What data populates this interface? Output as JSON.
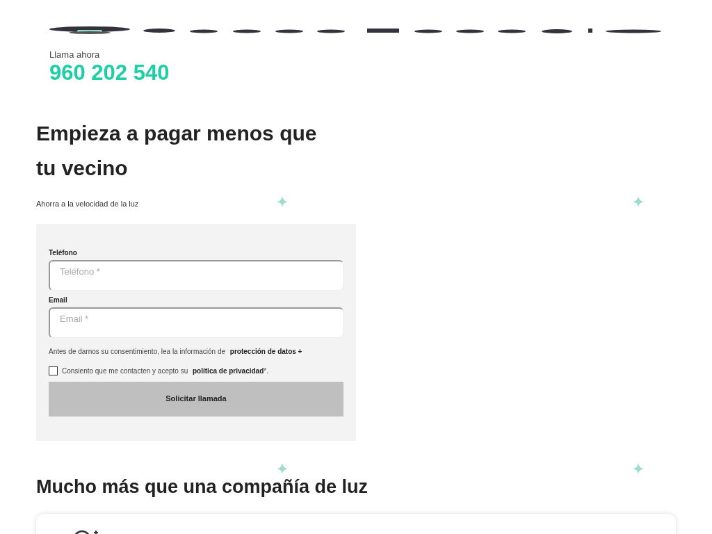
{
  "header": {
    "call_label": "Llama ahora",
    "phone": "960 202 540"
  },
  "hero": {
    "title": "Empieza a pagar menos que tu vecino",
    "subtitle": "Ahorra a la velocidad de la luz"
  },
  "form": {
    "fields": [
      {
        "label": "Teléfono",
        "placeholder": "Teléfono *"
      },
      {
        "label": "Email",
        "placeholder": "Email *"
      }
    ],
    "privacy_note": "Antes de darnos su consentimiento, lea la información de",
    "privacy_link": "protección de datos +",
    "consent": {
      "text": "Consiento que me contacten y acepto su",
      "link": "política de privacidad",
      "suffix": "*.",
      "checked": false
    },
    "button": "Solicitar llamada"
  },
  "section": {
    "title": "Mucho más que una compañía de luz"
  }
}
